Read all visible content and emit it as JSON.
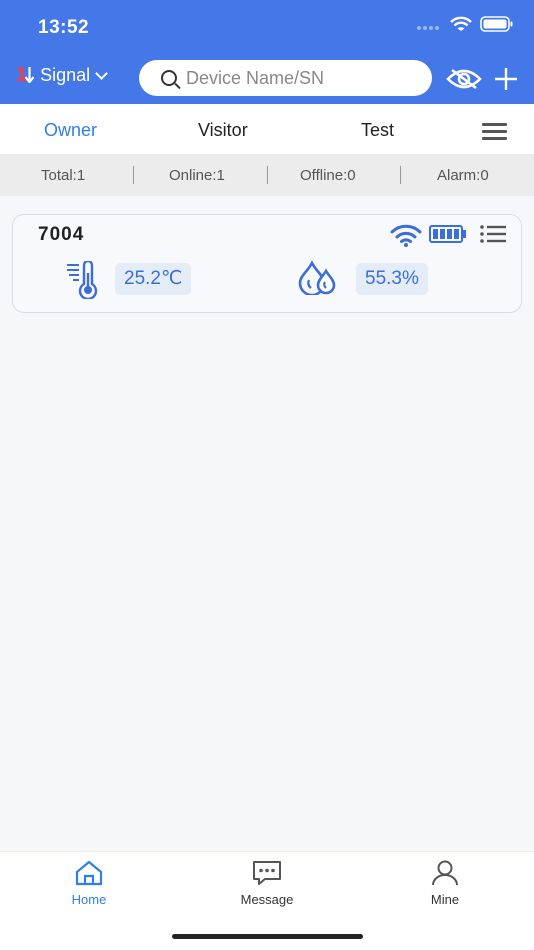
{
  "status_bar": {
    "time": "13:52"
  },
  "header": {
    "signal_logo": "1",
    "signal_label": "Signal",
    "search_placeholder": "Device Name/SN"
  },
  "tabs": [
    {
      "label": "Owner",
      "active": true
    },
    {
      "label": "Visitor",
      "active": false
    },
    {
      "label": "Test",
      "active": false
    }
  ],
  "stats": {
    "total": "Total:1",
    "online": "Online:1",
    "offline": "Offline:0",
    "alarm": "Alarm:0"
  },
  "device": {
    "name": "7004",
    "temperature": "25.2℃",
    "humidity": "55.3%",
    "connection": "wifi",
    "battery_level": 1.0
  },
  "bottom_nav": [
    {
      "label": "Home",
      "active": true,
      "icon": "home-icon"
    },
    {
      "label": "Message",
      "active": false,
      "icon": "message-icon"
    },
    {
      "label": "Mine",
      "active": false,
      "icon": "user-icon"
    }
  ],
  "colors": {
    "header_blue": "#4477e8",
    "accent_blue": "#2f7fe6",
    "value_blue": "#3b6ed9",
    "logo_red": "#ff3b3b"
  }
}
